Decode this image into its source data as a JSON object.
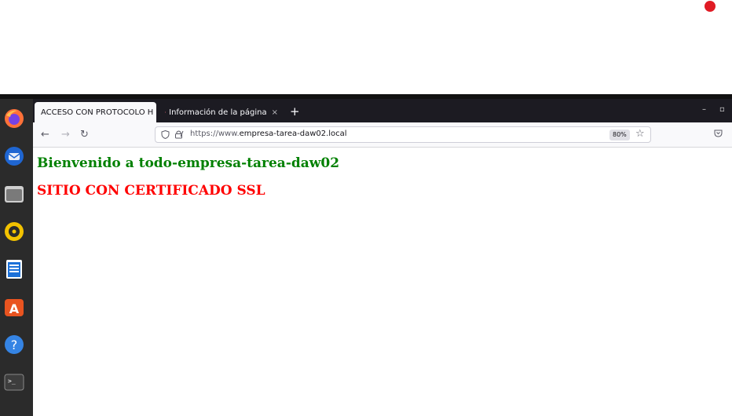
{
  "browser": {
    "tabs": [
      {
        "label": "ACCESO CON PROTOCOLO H",
        "active": true
      },
      {
        "label": "Información de la página",
        "active": false
      }
    ],
    "new_tab": "+",
    "close_glyph": "×",
    "url_prefix": "https://www.",
    "url_domain": "empresa-tarea-daw02.local",
    "zoom": "80%"
  },
  "page": {
    "heading1": "Bienvenido a todo-empresa-tarea-daw02",
    "heading2": "SITIO CON CERTIFICADO SSL",
    "heading1_color": "#008000",
    "heading2_color": "#ff0000"
  },
  "dock": {
    "items": [
      "firefox-icon",
      "thunderbird-icon",
      "files-icon",
      "rhythmbox-icon",
      "libreoffice-writer-icon",
      "software-center-icon",
      "help-icon",
      "terminal-icon"
    ]
  },
  "colors": {
    "recording_dot": "#e01b24",
    "dock_bg": "#2b2b2b",
    "tabbar_bg": "#1c1b22"
  }
}
